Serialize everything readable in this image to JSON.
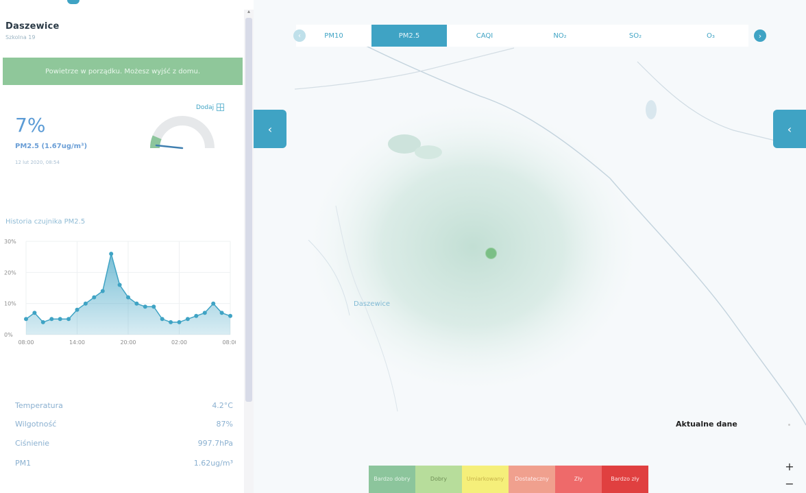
{
  "station": {
    "name": "Daszewice",
    "street": "Szkolna 19"
  },
  "status": {
    "message": "Powietrze w porządku. Możesz wyjść z domu."
  },
  "add_link": {
    "label": "Dodaj"
  },
  "reading": {
    "percent": "7%",
    "pm_text": "PM2.5 (1.67ug/m³)",
    "time": "12 lut 2020, 08:54",
    "gauge_fraction": 0.07
  },
  "history": {
    "title": "Historia czujnika PM2.5"
  },
  "chart_data": {
    "type": "area",
    "title": "Historia czujnika PM2.5",
    "x_tick_labels": [
      "08:00",
      "14:00",
      "20:00",
      "02:00",
      "08:00"
    ],
    "y_tick_labels": [
      "0%",
      "10%",
      "20%",
      "30%"
    ],
    "ylim": [
      0,
      30
    ],
    "x": [
      0,
      1,
      2,
      3,
      4,
      5,
      6,
      7,
      8,
      9,
      10,
      11,
      12,
      13,
      14,
      15,
      16,
      17,
      18,
      19,
      20,
      21,
      22,
      23,
      24
    ],
    "values": [
      5,
      7,
      4,
      5,
      5,
      5,
      8,
      10,
      12,
      14,
      26,
      16,
      12,
      10,
      9,
      9,
      5,
      4,
      4,
      5,
      6,
      7,
      10,
      7,
      6
    ],
    "color": "#3fa3c4",
    "grid": true
  },
  "stats": [
    {
      "label": "Temperatura",
      "value": "4.2°C"
    },
    {
      "label": "Wilgotność",
      "value": "87%"
    },
    {
      "label": "Ciśnienie",
      "value": "997.7hPa"
    },
    {
      "label": "PM1",
      "value": "1.62ug/m³"
    }
  ],
  "map": {
    "tabs": [
      {
        "label": "PM10",
        "active": false
      },
      {
        "label": "PM2.5",
        "active": true
      },
      {
        "label": "CAQI",
        "active": false
      },
      {
        "label": "NO₂",
        "active": false
      },
      {
        "label": "SO₂",
        "active": false
      },
      {
        "label": "O₃",
        "active": false
      }
    ],
    "town_label": "Daszewice",
    "current_data_label": "Aktualne dane",
    "zoom_in": "+",
    "zoom_out": "−",
    "prev_icon": "‹",
    "next_icon": "›",
    "collapse_icon": "‹",
    "expand_icon": "‹"
  },
  "legend": [
    {
      "label": "Bardzo dobry",
      "color": "#8cc59c",
      "text_color": "#e4f3e8"
    },
    {
      "label": "Dobry",
      "color": "#b7dd9b",
      "text_color": "#6f8f56"
    },
    {
      "label": "Umiarkowany",
      "color": "#f5ef7a",
      "text_color": "#c7b34a"
    },
    {
      "label": "Dostateczny",
      "color": "#f0a08e",
      "text_color": "#ffecec"
    },
    {
      "label": "Zły",
      "color": "#ee6a6a",
      "text_color": "#ffe6e6"
    },
    {
      "label": "Bardzo zły",
      "color": "#e04040",
      "text_color": "#ffe0e0"
    }
  ]
}
